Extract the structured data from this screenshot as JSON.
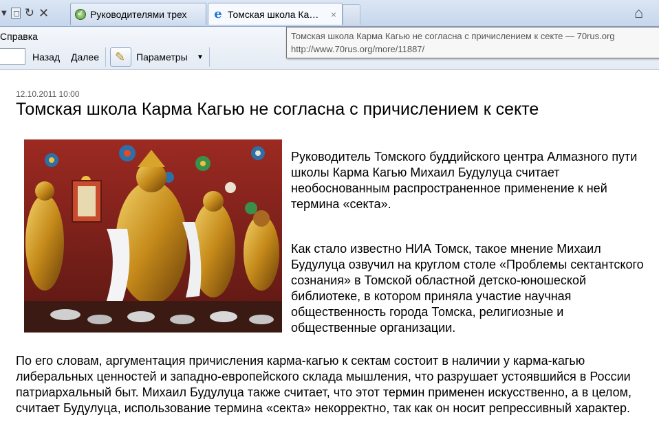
{
  "browser": {
    "tabs": [
      {
        "label": "Руководителями трех",
        "active": false
      },
      {
        "label": "Томская школа Ка…",
        "active": true
      }
    ],
    "tab_close_glyph": "×",
    "menu_help": "Справка",
    "back_label": "Назад",
    "forward_label": "Далее",
    "params_label": "Параметры",
    "tooltip": {
      "title": "Томская школа Карма Кагью не согласна с причислением к секте — 70rus.org",
      "url": "http://www.70rus.org/more/11887/"
    },
    "icons": [
      "dropdown-arrow-icon",
      "compatibility-view-icon",
      "refresh-icon",
      "stop-icon",
      "site-favicon",
      "ie-favicon",
      "tab-close-icon",
      "home-icon",
      "highlighter-icon",
      "params-dropdown-icon"
    ]
  },
  "article": {
    "date": "12.10.2011 10:00",
    "title": "Томская школа Карма Кагью не согласна с причислением к секте",
    "lead": "Руководитель Томского буддийского центра Алмазного пути школы Карма Кагью Михаил Будулуца считает необоснованным распространенное применение к ней термина «секта».",
    "p2": "Как стало известно НИА Томск, такое мнение Михаил Будулуца озвучил на круглом столе «Проблемы сектантского сознания» в Томской областной детско-юношеской библиотеке, в котором приняла участие научная общественность города Томска, религиозные и общественные организации.",
    "p3": "По его словам, аргументация причисления карма-кагью к сектам состоит в наличии у карма-кагью либеральных ценностей и западно-европейского склада мышления, что разрушает устоявшийся в России патриархальный быт. Михаил Будулуца также считает, что этот термин применен искусственно, а в целом, считает Будулуца, использование термина «секта» некорректно, так как он носит репрессивный характер."
  },
  "colors": {
    "tabbar": "#c6d6ec",
    "ie_blue": "#1e73d6",
    "text": "#000000",
    "date": "#555555"
  }
}
